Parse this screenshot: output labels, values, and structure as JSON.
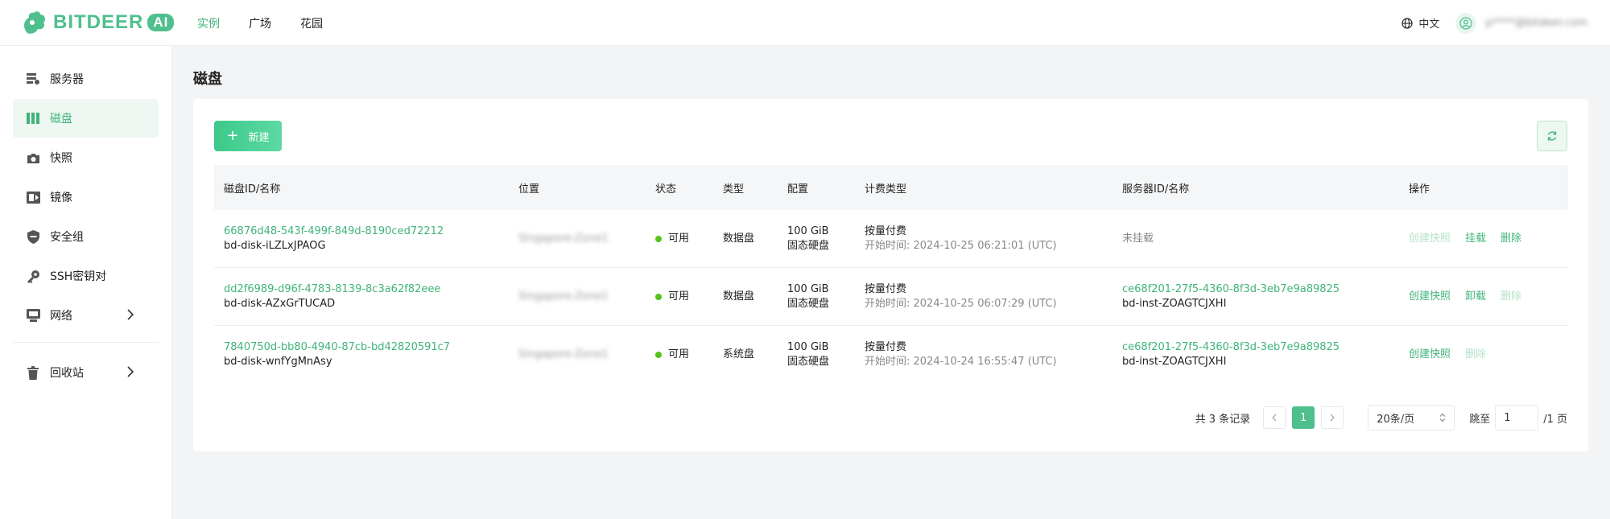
{
  "brand": {
    "name": "BITDEER",
    "ai_badge": "AI",
    "color": "#4fc08d"
  },
  "topnav": [
    {
      "label": "实例",
      "active": true
    },
    {
      "label": "广场",
      "active": false
    },
    {
      "label": "花园",
      "active": false
    }
  ],
  "header_right": {
    "language": "中文",
    "user_email": "yi****@bitdeer.com"
  },
  "sidebar": {
    "items": [
      {
        "label": "服务器",
        "icon": "server-icon"
      },
      {
        "label": "磁盘",
        "icon": "disk-icon",
        "active": true
      },
      {
        "label": "快照",
        "icon": "camera-icon"
      },
      {
        "label": "镜像",
        "icon": "image-icon"
      },
      {
        "label": "安全组",
        "icon": "shield-icon"
      },
      {
        "label": "SSH密钥对",
        "icon": "key-icon"
      },
      {
        "label": "网络",
        "icon": "network-icon"
      }
    ],
    "recycle": {
      "label": "回收站",
      "icon": "trash-icon"
    }
  },
  "page": {
    "title": "磁盘",
    "new_button": "新建"
  },
  "table": {
    "headers": [
      "磁盘ID/名称",
      "位置",
      "状态",
      "类型",
      "配置",
      "计费类型",
      "服务器ID/名称",
      "操作"
    ],
    "rows": [
      {
        "disk_id": "66876d48-543f-499f-849d-8190ced72212",
        "disk_name": "bd-disk-iLZLxJPAOG",
        "location": "Singapore-Zone1",
        "status": "可用",
        "type": "数据盘",
        "size": "100 GiB",
        "media": "固态硬盘",
        "billing": "按量付费",
        "start_time": "开始时间: 2024-10-25 06:21:01 (UTC)",
        "server_id": "未挂载",
        "server_name": "",
        "ops": [
          {
            "label": "创建快照",
            "enabled": false
          },
          {
            "label": "挂载",
            "enabled": true
          },
          {
            "label": "删除",
            "enabled": true
          }
        ]
      },
      {
        "disk_id": "dd2f6989-d96f-4783-8139-8c3a62f82eee",
        "disk_name": "bd-disk-AZxGrTUCAD",
        "location": "Singapore-Zone1",
        "status": "可用",
        "type": "数据盘",
        "size": "100 GiB",
        "media": "固态硬盘",
        "billing": "按量付费",
        "start_time": "开始时间: 2024-10-25 06:07:29 (UTC)",
        "server_id": "ce68f201-27f5-4360-8f3d-3eb7e9a89825",
        "server_name": "bd-inst-ZOAGTCJXHI",
        "ops": [
          {
            "label": "创建快照",
            "enabled": true
          },
          {
            "label": "卸载",
            "enabled": true
          },
          {
            "label": "删除",
            "enabled": false
          }
        ]
      },
      {
        "disk_id": "7840750d-bb80-4940-87cb-bd42820591c7",
        "disk_name": "bd-disk-wnfYgMnAsy",
        "location": "Singapore-Zone1",
        "status": "可用",
        "type": "系统盘",
        "size": "100 GiB",
        "media": "固态硬盘",
        "billing": "按量付费",
        "start_time": "开始时间: 2024-10-24 16:55:47 (UTC)",
        "server_id": "ce68f201-27f5-4360-8f3d-3eb7e9a89825",
        "server_name": "bd-inst-ZOAGTCJXHI",
        "ops": [
          {
            "label": "创建快照",
            "enabled": true
          },
          {
            "label": "删除",
            "enabled": false
          }
        ]
      }
    ]
  },
  "pagination": {
    "total": "共 3 条记录",
    "current_page": "1",
    "page_size": "20条/页",
    "jump_label": "跳至",
    "jump_value": "1",
    "page_total": "/1 页"
  }
}
